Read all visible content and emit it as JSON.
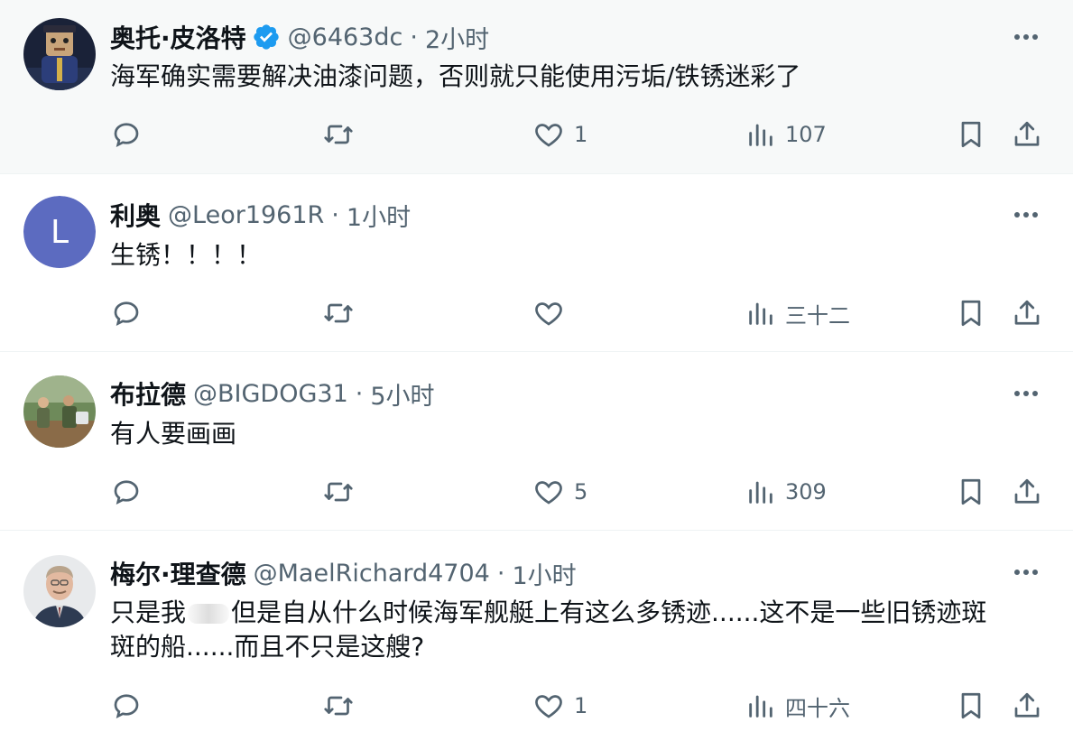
{
  "tweets": [
    {
      "name": "奥托·皮洛特",
      "verified": true,
      "handle": "@6463dc",
      "time": "2小时",
      "text": "海军确实需要解决油漆问题，否则就只能使用污垢/铁锈迷彩了",
      "likes": "1",
      "views": "107",
      "avatar_icon": "cartoon-pilot-avatar"
    },
    {
      "name": "利奥",
      "verified": false,
      "handle": "@Leor1961R",
      "time": "1小时",
      "text": "生锈！！！！",
      "likes": "",
      "views": "三十二",
      "avatar_letter": "L",
      "avatar_color": "#5c6bc0"
    },
    {
      "name": "布拉德",
      "verified": false,
      "handle": "@BIGDOG31",
      "time": "5小时",
      "text": "有人要画画",
      "likes": "5",
      "views": "309",
      "avatar_icon": "outdoor-photo-avatar"
    },
    {
      "name": "梅尔·理查德",
      "verified": false,
      "handle": "@MaelRichard4704",
      "time": "1小时",
      "text_part1": "只是我",
      "text_part2": "但是自从什么时候海军舰艇上有这么多锈迹......这不是一些旧锈迹斑",
      "text_line2": "斑的船......而且不只是这艘?",
      "likes": "1",
      "views": "四十六",
      "avatar_icon": "man-portrait-avatar"
    }
  ],
  "separator": "·",
  "colors": {
    "verified": "#1d9bf0",
    "secondary_text": "#536471",
    "highlight_bg": "#f7f9f9"
  }
}
